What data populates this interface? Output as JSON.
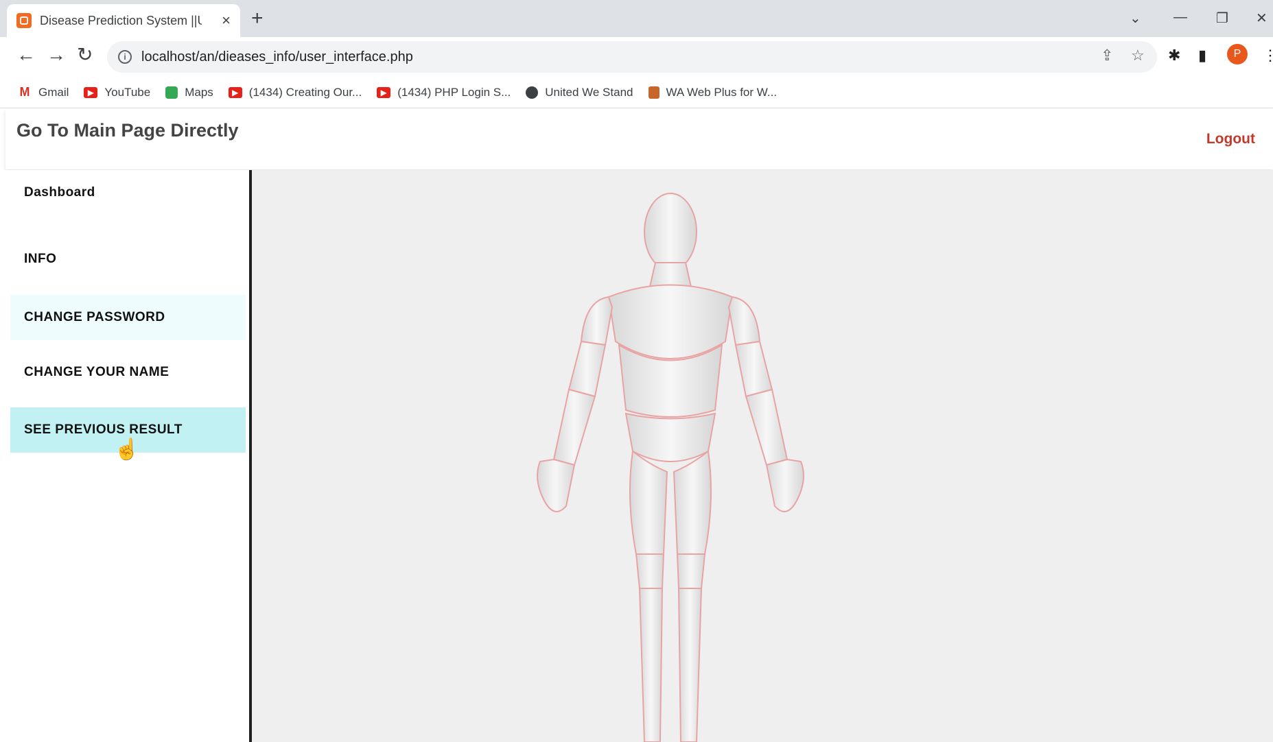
{
  "browser": {
    "tab_title": "Disease Prediction System ||User",
    "new_tab": "+",
    "url": "localhost/an/dieases_info/user_interface.php",
    "profile_initial": "P",
    "bookmarks": [
      {
        "label": "Gmail",
        "icon": "gmail-icon"
      },
      {
        "label": "YouTube",
        "icon": "youtube-icon"
      },
      {
        "label": "Maps",
        "icon": "maps-icon"
      },
      {
        "label": "(1434) Creating Our...",
        "icon": "youtube-icon"
      },
      {
        "label": "(1434) PHP Login S...",
        "icon": "youtube-icon"
      },
      {
        "label": "United We Stand",
        "icon": "globe-icon"
      },
      {
        "label": "WA Web Plus for W...",
        "icon": "wa-icon"
      }
    ]
  },
  "header": {
    "title": "Go To Main Page Directly",
    "logout": "Logout"
  },
  "sidebar": {
    "items": [
      {
        "label": "Dashboard"
      },
      {
        "label": "INFO"
      },
      {
        "label": "CHANGE PASSWORD"
      },
      {
        "label": "CHANGE YOUR NAME"
      },
      {
        "label": "SEE PREVIOUS RESULT"
      }
    ]
  },
  "colors": {
    "logout": "#c0392b",
    "active_item": "#c2f1f4",
    "soft_item": "#eefcfd",
    "body_outline": "#e8a3a3"
  }
}
